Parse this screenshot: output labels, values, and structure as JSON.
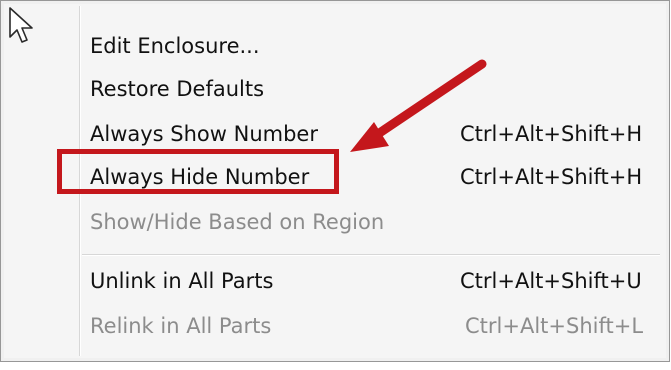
{
  "menu": {
    "items": [
      {
        "label": "Edit Enclosure...",
        "shortcut": "",
        "enabled": true
      },
      {
        "label": "Restore Defaults",
        "shortcut": "",
        "enabled": true
      },
      {
        "label": "Always Show Number",
        "shortcut": "Ctrl+Alt+Shift+H",
        "enabled": true
      },
      {
        "label": "Always Hide Number",
        "shortcut": "Ctrl+Alt+Shift+H",
        "enabled": true
      },
      {
        "label": "Show/Hide Based on Region",
        "shortcut": "",
        "enabled": false
      },
      {
        "label": "Unlink in All Parts",
        "shortcut": "Ctrl+Alt+Shift+U",
        "enabled": true
      },
      {
        "label": "Relink in All Parts",
        "shortcut": "Ctrl+Alt+Shift+L",
        "enabled": false
      }
    ]
  },
  "annotation": {
    "highlight_color": "#c4171c",
    "arrow_color": "#c4171c",
    "highlighted_item": "Always Hide Number"
  },
  "icons": {
    "cursor": "mouse-pointer-icon"
  }
}
